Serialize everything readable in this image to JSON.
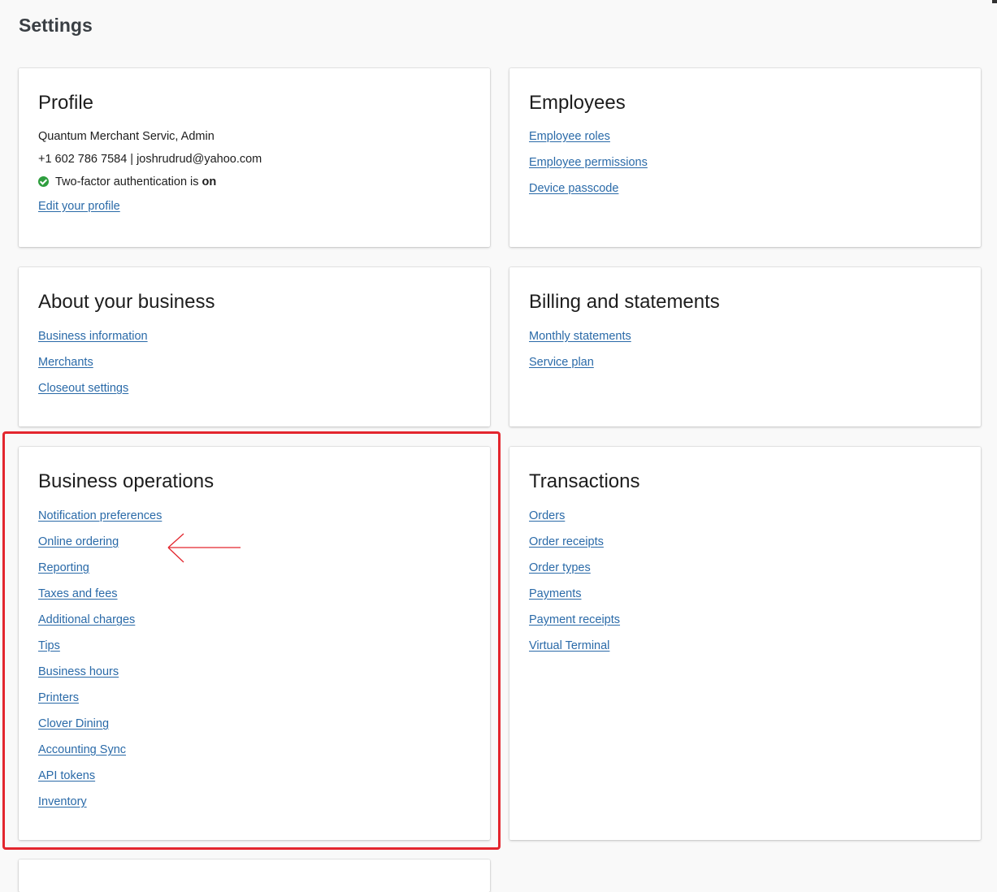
{
  "page": {
    "title": "Settings"
  },
  "profile": {
    "title": "Profile",
    "name_line": "Quantum Merchant Servic, Admin",
    "contact_line": "+1 602 786 7584 | joshrudrud@yahoo.com",
    "twofa_prefix": "Two-factor authentication is ",
    "twofa_status": "on",
    "edit_link": "Edit your profile"
  },
  "employees": {
    "title": "Employees",
    "links": [
      "Employee roles",
      "Employee permissions",
      "Device passcode"
    ]
  },
  "about_business": {
    "title": "About your business",
    "links": [
      "Business information",
      "Merchants",
      "Closeout settings"
    ]
  },
  "billing": {
    "title": "Billing and statements",
    "links": [
      "Monthly statements",
      "Service plan"
    ]
  },
  "business_operations": {
    "title": "Business operations",
    "links": [
      "Notification preferences",
      "Online ordering",
      "Reporting",
      "Taxes and fees",
      "Additional charges",
      "Tips",
      "Business hours",
      "Printers",
      "Clover Dining",
      "Accounting Sync",
      "API tokens",
      "Inventory"
    ]
  },
  "transactions": {
    "title": "Transactions",
    "links": [
      "Orders",
      "Order receipts",
      "Order types",
      "Payments",
      "Payment receipts",
      "Virtual Terminal"
    ]
  },
  "icons": {
    "twofa": "check-circle-icon",
    "annotation_arrow": "left-arrow-icon"
  },
  "colors": {
    "link": "#2a6aa8",
    "success": "#2e9e3e",
    "annotation": "#e3262e",
    "background": "#f9f9f9"
  }
}
